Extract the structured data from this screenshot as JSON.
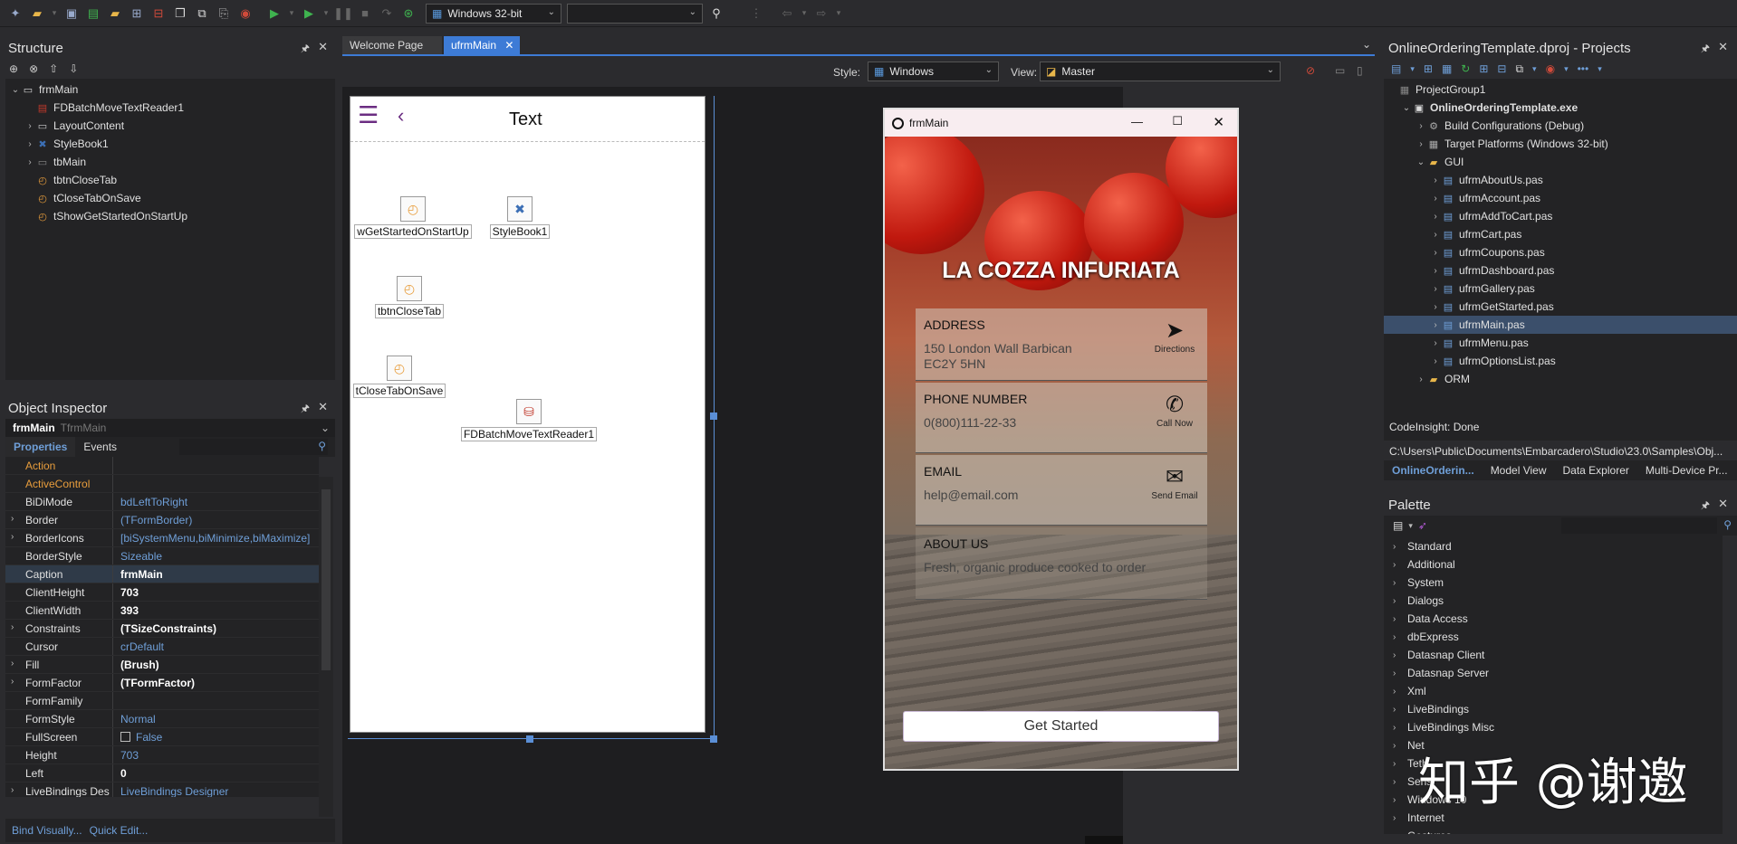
{
  "toolbar": {
    "platform": "Windows 32-bit",
    "config": ""
  },
  "structure": {
    "title": "Structure",
    "items": [
      {
        "label": "frmMain",
        "depth": 0,
        "expand": "v"
      },
      {
        "label": "FDBatchMoveTextReader1",
        "depth": 1,
        "expand": ""
      },
      {
        "label": "LayoutContent",
        "depth": 1,
        "expand": ">"
      },
      {
        "label": "StyleBook1",
        "depth": 1,
        "expand": ">"
      },
      {
        "label": "tbMain",
        "depth": 1,
        "expand": ">"
      },
      {
        "label": "tbtnCloseTab",
        "depth": 1,
        "expand": ""
      },
      {
        "label": "tCloseTabOnSave",
        "depth": 1,
        "expand": ""
      },
      {
        "label": "tShowGetStartedOnStartUp",
        "depth": 1,
        "expand": ""
      }
    ]
  },
  "inspector": {
    "title": "Object Inspector",
    "object": "frmMain",
    "type": "TfrmMain",
    "tab_properties": "Properties",
    "tab_events": "Events",
    "rows": [
      {
        "k": "Action",
        "v": "",
        "kc": "orange",
        "vc": "",
        "e": ""
      },
      {
        "k": "ActiveControl",
        "v": "",
        "kc": "orange",
        "vc": "",
        "e": ""
      },
      {
        "k": "BiDiMode",
        "v": "bdLeftToRight",
        "kc": "",
        "vc": "blue",
        "e": ""
      },
      {
        "k": "Border",
        "v": "(TFormBorder)",
        "kc": "",
        "vc": "blue",
        "e": ">"
      },
      {
        "k": "BorderIcons",
        "v": "[biSystemMenu,biMinimize,biMaximize]",
        "kc": "",
        "vc": "blue",
        "e": ">"
      },
      {
        "k": "BorderStyle",
        "v": "Sizeable",
        "kc": "",
        "vc": "blue",
        "e": ""
      },
      {
        "k": "Caption",
        "v": "frmMain",
        "kc": "",
        "vc": "bold",
        "e": ""
      },
      {
        "k": "ClientHeight",
        "v": "703",
        "kc": "",
        "vc": "bold",
        "e": ""
      },
      {
        "k": "ClientWidth",
        "v": "393",
        "kc": "",
        "vc": "bold",
        "e": ""
      },
      {
        "k": "Constraints",
        "v": "(TSizeConstraints)",
        "kc": "",
        "vc": "bold",
        "e": ">"
      },
      {
        "k": "Cursor",
        "v": "crDefault",
        "kc": "",
        "vc": "blue",
        "e": ""
      },
      {
        "k": "Fill",
        "v": "(Brush)",
        "kc": "",
        "vc": "bold",
        "e": ">"
      },
      {
        "k": "FormFactor",
        "v": "(TFormFactor)",
        "kc": "",
        "vc": "bold",
        "e": ">"
      },
      {
        "k": "FormFamily",
        "v": "",
        "kc": "",
        "vc": "",
        "e": ""
      },
      {
        "k": "FormStyle",
        "v": "Normal",
        "kc": "",
        "vc": "blue",
        "e": ""
      },
      {
        "k": "FullScreen",
        "v": "False",
        "kc": "",
        "vc": "blue",
        "e": ""
      },
      {
        "k": "Height",
        "v": "703",
        "kc": "",
        "vc": "blue",
        "e": ""
      },
      {
        "k": "Left",
        "v": "0",
        "kc": "",
        "vc": "bold",
        "e": ""
      },
      {
        "k": "LiveBindings Des",
        "v": "LiveBindings Designer",
        "kc": "",
        "vc": "blue",
        "e": ">"
      }
    ],
    "footer_bind": "Bind Visually...",
    "footer_edit": "Quick Edit..."
  },
  "tabs": {
    "welcome": "Welcome Page",
    "main": "ufrmMain"
  },
  "design_bar": {
    "style_label": "Style:",
    "style_value": "Windows",
    "view_label": "View:",
    "view_value": "Master"
  },
  "form": {
    "header_text": "Text",
    "components": [
      {
        "label": "wGetStartedOnStartUp"
      },
      {
        "label": "StyleBook1"
      },
      {
        "label": "tbtnCloseTab"
      },
      {
        "label": "tCloseTabOnSave"
      },
      {
        "label": "FDBatchMoveTextReader1"
      }
    ]
  },
  "phone": {
    "title": "frmMain",
    "brand": "LA COZZA INFURIATA",
    "cards": [
      {
        "heading": "ADDRESS",
        "value": "150 London Wall Barbican\nEC2Y 5HN",
        "action": "Directions"
      },
      {
        "heading": "PHONE NUMBER",
        "value": "0(800)111-22-33",
        "action": "Call Now"
      },
      {
        "heading": "EMAIL",
        "value": "help@email.com",
        "action": "Send Email"
      },
      {
        "heading": "ABOUT US",
        "value": "Fresh, organic produce cooked to order",
        "action": ""
      }
    ],
    "button": "Get Started"
  },
  "projects": {
    "title": "OnlineOrderingTemplate.dproj - Projects",
    "items": [
      {
        "label": "ProjectGroup1",
        "depth": 0,
        "expand": "",
        "bold": false
      },
      {
        "label": "OnlineOrderingTemplate.exe",
        "depth": 1,
        "expand": "v",
        "bold": true
      },
      {
        "label": "Build Configurations (Debug)",
        "depth": 2,
        "expand": ">",
        "bold": false
      },
      {
        "label": "Target Platforms (Windows 32-bit)",
        "depth": 2,
        "expand": ">",
        "bold": false
      },
      {
        "label": "GUI",
        "depth": 2,
        "expand": "v",
        "bold": false
      },
      {
        "label": "ufrmAboutUs.pas",
        "depth": 3,
        "expand": ">",
        "bold": false
      },
      {
        "label": "ufrmAccount.pas",
        "depth": 3,
        "expand": ">",
        "bold": false
      },
      {
        "label": "ufrmAddToCart.pas",
        "depth": 3,
        "expand": ">",
        "bold": false
      },
      {
        "label": "ufrmCart.pas",
        "depth": 3,
        "expand": ">",
        "bold": false
      },
      {
        "label": "ufrmCoupons.pas",
        "depth": 3,
        "expand": ">",
        "bold": false
      },
      {
        "label": "ufrmDashboard.pas",
        "depth": 3,
        "expand": ">",
        "bold": false
      },
      {
        "label": "ufrmGallery.pas",
        "depth": 3,
        "expand": ">",
        "bold": false
      },
      {
        "label": "ufrmGetStarted.pas",
        "depth": 3,
        "expand": ">",
        "bold": false
      },
      {
        "label": "ufrmMain.pas",
        "depth": 3,
        "expand": ">",
        "bold": false
      },
      {
        "label": "ufrmMenu.pas",
        "depth": 3,
        "expand": ">",
        "bold": false
      },
      {
        "label": "ufrmOptionsList.pas",
        "depth": 3,
        "expand": ">",
        "bold": false
      },
      {
        "label": "ORM",
        "depth": 2,
        "expand": ">",
        "bold": false
      }
    ],
    "codeinsight": "CodeInsight: Done",
    "path": "C:\\Users\\Public\\Documents\\Embarcadero\\Studio\\23.0\\Samples\\Obj...",
    "tabs": [
      "OnlineOrderin...",
      "Model View",
      "Data Explorer",
      "Multi-Device Pr..."
    ]
  },
  "palette": {
    "title": "Palette",
    "items": [
      "Standard",
      "Additional",
      "System",
      "Dialogs",
      "Data Access",
      "dbExpress",
      "Datasnap Client",
      "Datasnap Server",
      "Xml",
      "LiveBindings",
      "LiveBindings Misc",
      "Net",
      "Teth",
      "Sens",
      "Windows 10",
      "Internet",
      "Gestures"
    ]
  },
  "watermark": "知乎 @谢邀"
}
